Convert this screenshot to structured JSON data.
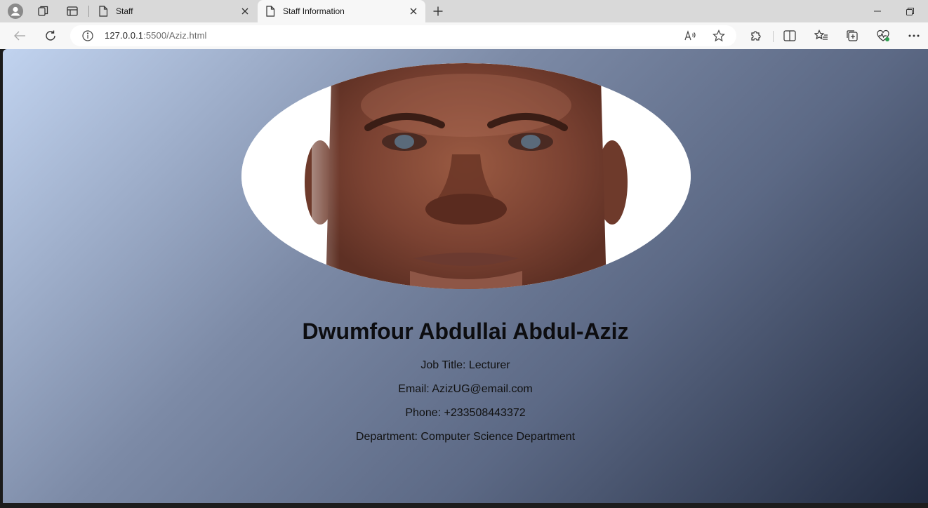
{
  "browser": {
    "tabs": [
      {
        "title": "Staff",
        "active": false
      },
      {
        "title": "Staff Information",
        "active": true
      }
    ],
    "url": {
      "host": "127.0.0.1",
      "rest": ":5500/Aziz.html"
    },
    "icons": {
      "profile": "profile-icon",
      "workspaces": "workspaces-icon",
      "tab_actions": "tab-actions-icon",
      "page": "page-icon",
      "close": "close-icon",
      "new_tab": "plus-icon",
      "minimize": "minimize-icon",
      "restore": "restore-icon",
      "back": "back-arrow-icon",
      "refresh": "refresh-icon",
      "info": "info-icon",
      "read_aloud": "read-aloud-icon",
      "favorite": "star-icon",
      "extensions": "puzzle-icon",
      "split_screen": "split-screen-icon",
      "favorites": "favorites-icon",
      "collections": "collections-icon",
      "browser_essentials": "heart-pulse-icon",
      "more": "more-icon"
    }
  },
  "page": {
    "background": {
      "from": "#c1d3ef",
      "to": "#222b40"
    },
    "photo_alt": "Staff photo",
    "name": "Dwumfour Abdullai Abdul-Aziz",
    "details": [
      {
        "label": "Job Title",
        "value": "Lecturer",
        "text": "Job Title: Lecturer"
      },
      {
        "label": "Email",
        "value": "AzizUG@email.com",
        "text": "Email: AzizUG@email.com"
      },
      {
        "label": "Phone",
        "value": "+233508443372",
        "text": "Phone: +233508443372"
      },
      {
        "label": "Department",
        "value": "Computer Science Department",
        "text": "Department: Computer Science Department"
      }
    ]
  }
}
